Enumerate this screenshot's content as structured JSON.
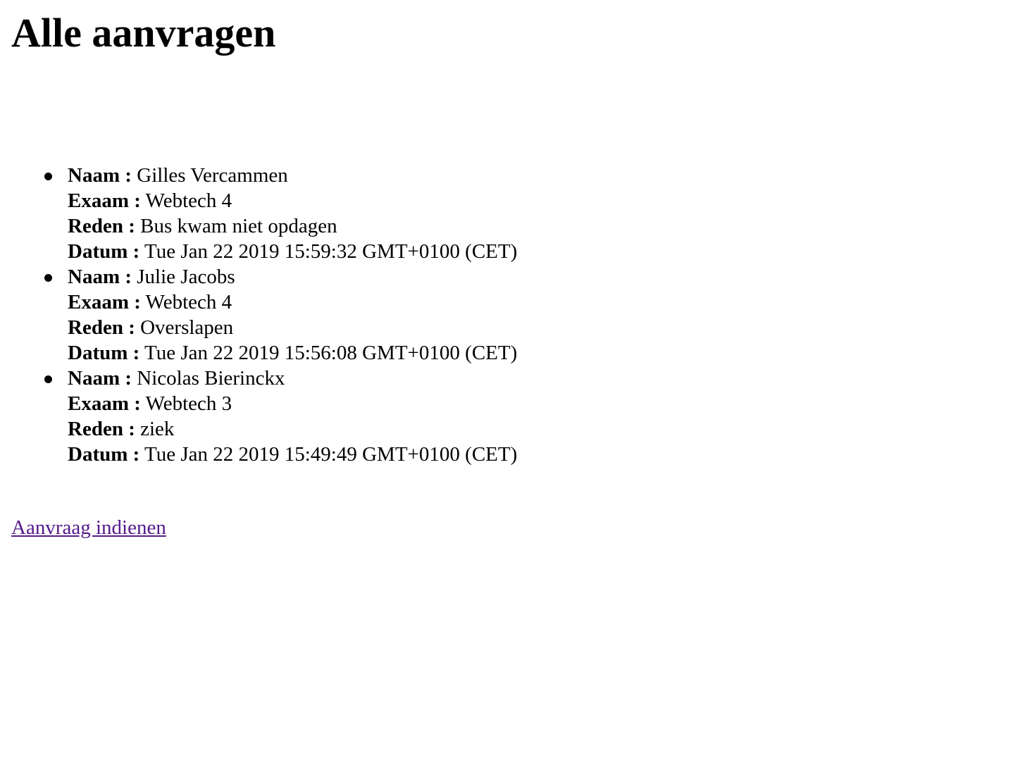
{
  "page": {
    "title": "Alle aanvragen",
    "labels": {
      "naam": "Naam :",
      "exaam": "Exaam :",
      "reden": "Reden :",
      "datum": "Datum :"
    },
    "requests": [
      {
        "naam": "Gilles Vercammen",
        "exaam": "Webtech 4",
        "reden": "Bus kwam niet opdagen",
        "datum": "Tue Jan 22 2019 15:59:32 GMT+0100 (CET)"
      },
      {
        "naam": "Julie Jacobs",
        "exaam": "Webtech 4",
        "reden": "Overslapen",
        "datum": "Tue Jan 22 2019 15:56:08 GMT+0100 (CET)"
      },
      {
        "naam": "Nicolas Bierinckx",
        "exaam": "Webtech 3",
        "reden": "ziek",
        "datum": "Tue Jan 22 2019 15:49:49 GMT+0100 (CET)"
      }
    ],
    "link_label": "Aanvraag indienen"
  },
  "colors": {
    "text": "#000000",
    "visited_link": "#551a8b",
    "background": "#ffffff"
  }
}
